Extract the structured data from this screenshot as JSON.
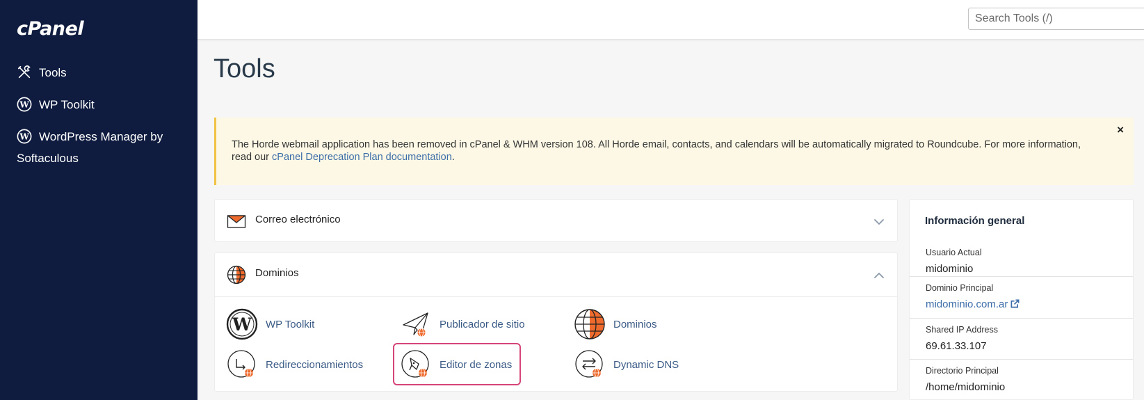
{
  "brand": {
    "logo_text": "cPanel"
  },
  "sidebar": {
    "items": [
      {
        "label": "Tools",
        "icon": "tools-icon"
      },
      {
        "label": "WP Toolkit",
        "icon": "wordpress-icon"
      },
      {
        "label": "WordPress Manager by Softaculous",
        "icon": "wordpress-icon"
      }
    ]
  },
  "header": {
    "search_placeholder": "Search Tools (/)"
  },
  "main": {
    "title": "Tools",
    "alert": {
      "text": "The Horde webmail application has been removed in cPanel & WHM version 108. All Horde email, contacts, and calendars will be automatically migrated to Roundcube. For more information, read our ",
      "link": "cPanel Deprecation Plan documentation",
      "suffix": ".",
      "close": "×"
    },
    "sections": [
      {
        "title": "Correo electrónico",
        "icon": "envelope-icon",
        "expanded": false
      },
      {
        "title": "Dominios",
        "icon": "globe-icon",
        "expanded": true,
        "tools": [
          {
            "label": "WP Toolkit",
            "icon": "wordpress-icon"
          },
          {
            "label": "Publicador de sitio",
            "icon": "paper-plane-icon"
          },
          {
            "label": "Dominios",
            "icon": "globe-icon"
          },
          {
            "label": "Redireccionamientos",
            "icon": "redirect-icon"
          },
          {
            "label": "Editor de zonas",
            "icon": "zone-editor-icon",
            "highlighted": true
          },
          {
            "label": "Dynamic DNS",
            "icon": "dynamic-dns-icon"
          }
        ]
      }
    ]
  },
  "info_panel": {
    "title": "Información general",
    "rows": [
      {
        "label": "Usuario Actual",
        "value": "midominio"
      },
      {
        "label": "Dominio Principal",
        "value": "midominio.com.ar"
      },
      {
        "label": "Shared IP Address",
        "value": "69.61.33.107"
      },
      {
        "label": "Directorio Principal",
        "value": "/home/midominio"
      }
    ]
  },
  "colors": {
    "sidebar_bg": "#0f1c3f",
    "accent_orange": "#ee6b2d",
    "link_blue": "#3c6da8",
    "highlight_pink": "#d6457a",
    "alert_bg": "#fcf8e5",
    "alert_border": "#f0c344"
  }
}
